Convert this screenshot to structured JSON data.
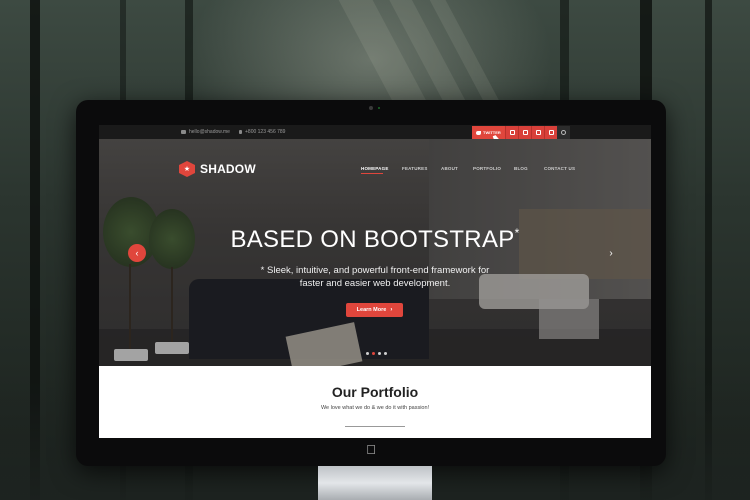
{
  "icons": {
    "email": "envelope-icon",
    "phone": "phone-icon",
    "twitter": "twitter-bird-icon",
    "search": "search-icon",
    "apple": "apple-logo-icon"
  },
  "colors": {
    "accent": "#e0463c",
    "topbar": "#1a1a1a"
  },
  "topbar": {
    "email": "hello@shadow.me",
    "phone": "+800 123 456 789",
    "twitter_label": "TWITTER"
  },
  "brand": {
    "name": "SHADOW"
  },
  "nav": {
    "items": [
      {
        "label": "HOMEPAGE",
        "active": true
      },
      {
        "label": "FEATURES",
        "active": false
      },
      {
        "label": "ABOUT",
        "active": false
      },
      {
        "label": "PORTFOLIO",
        "active": false
      },
      {
        "label": "BLOG",
        "active": false
      },
      {
        "label": "CONTACT US",
        "active": false
      }
    ]
  },
  "hero": {
    "headline": "BASED ON BOOTSTRAP",
    "headline_mark": "*",
    "subline_1": "* Sleek, intuitive, and powerful front-end framework for",
    "subline_2": "faster and easier web development.",
    "cta_label": "Learn More",
    "slides_total": 4,
    "slide_active": 1
  },
  "portfolio": {
    "title": "Our Portfolio",
    "subtitle": "We love what we do & we do it with passion!"
  }
}
